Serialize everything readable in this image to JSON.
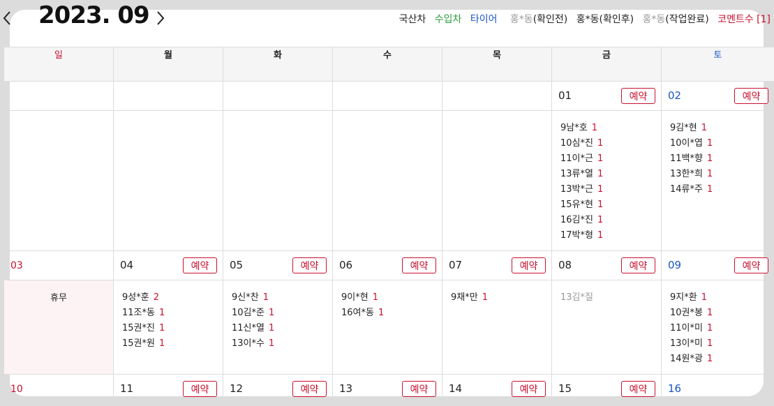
{
  "header": {
    "title": "2023. 09",
    "prev_glyph": "〈",
    "next_glyph": "〉",
    "legend": {
      "domestic": "국산차",
      "imported": "수입차",
      "tire": "타이어",
      "before_name": "홍*동",
      "before_label": "(확인전)",
      "after_name": "홍*동",
      "after_label": "(확인후)",
      "done_name": "홍*동",
      "done_label": "(작업완료)",
      "comment": "코멘트수 [1]"
    }
  },
  "weekdays": [
    "일",
    "월",
    "화",
    "수",
    "목",
    "금",
    "토"
  ],
  "reserve_label": "예약",
  "holiday_label": "휴무",
  "colors": {
    "accent_red": "#c8102e",
    "blue": "#1a56c4",
    "green": "#2a9d3a",
    "muted": "#999999"
  },
  "weeks": [
    {
      "dates": [
        "",
        "",
        "",
        "",
        "",
        "01",
        "02"
      ],
      "entries": {
        "fri": [
          {
            "time": "9",
            "name": "남*호",
            "count": "1"
          },
          {
            "time": "10",
            "name": "심*진",
            "count": "1"
          },
          {
            "time": "11",
            "name": "이*근",
            "count": "1"
          },
          {
            "time": "13",
            "name": "류*열",
            "count": "1"
          },
          {
            "time": "13",
            "name": "박*근",
            "count": "1"
          },
          {
            "time": "15",
            "name": "유*현",
            "count": "1"
          },
          {
            "time": "16",
            "name": "김*진",
            "count": "1"
          },
          {
            "time": "17",
            "name": "박*형",
            "count": "1"
          }
        ],
        "sat": [
          {
            "time": "9",
            "name": "김*현",
            "count": "1"
          },
          {
            "time": "10",
            "name": "이*엽",
            "count": "1"
          },
          {
            "time": "11",
            "name": "백*향",
            "count": "1"
          },
          {
            "time": "13",
            "name": "한*희",
            "count": "1"
          },
          {
            "time": "14",
            "name": "류*주",
            "count": "1"
          }
        ]
      }
    },
    {
      "dates": [
        "03",
        "04",
        "05",
        "06",
        "07",
        "08",
        "09"
      ],
      "entries": {
        "mon": [
          {
            "time": "9",
            "name": "성*훈",
            "count": "2"
          },
          {
            "time": "11",
            "name": "조*동",
            "count": "1"
          },
          {
            "time": "15",
            "name": "권*진",
            "count": "1"
          },
          {
            "time": "15",
            "name": "권*원",
            "count": "1"
          }
        ],
        "tue": [
          {
            "time": "9",
            "name": "신*찬",
            "count": "1"
          },
          {
            "time": "10",
            "name": "김*준",
            "count": "1"
          },
          {
            "time": "11",
            "name": "신*열",
            "count": "1"
          },
          {
            "time": "13",
            "name": "이*수",
            "count": "1"
          }
        ],
        "wed": [
          {
            "time": "9",
            "name": "이*현",
            "count": "1"
          },
          {
            "time": "16",
            "name": "여*동",
            "count": "1"
          }
        ],
        "thu": [
          {
            "time": "9",
            "name": "채*만",
            "count": "1"
          }
        ],
        "fri": [
          {
            "time": "13",
            "name": "김*질",
            "count": ""
          }
        ],
        "sat": [
          {
            "time": "9",
            "name": "지*환",
            "count": "1"
          },
          {
            "time": "10",
            "name": "권*봉",
            "count": "1"
          },
          {
            "time": "11",
            "name": "이*미",
            "count": "1"
          },
          {
            "time": "13",
            "name": "이*미",
            "count": "1"
          },
          {
            "time": "14",
            "name": "원*광",
            "count": "1"
          }
        ]
      }
    },
    {
      "dates": [
        "10",
        "11",
        "12",
        "13",
        "14",
        "15",
        "16"
      ]
    }
  ]
}
